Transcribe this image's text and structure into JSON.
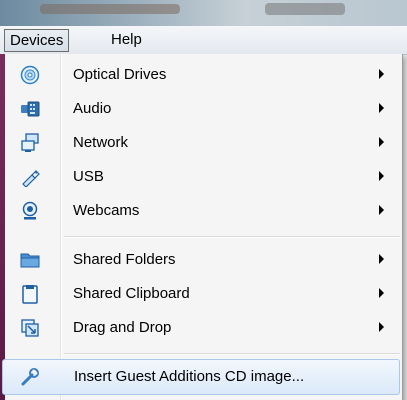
{
  "menubar": {
    "items": [
      {
        "label": "Devices"
      },
      {
        "label": "Help"
      }
    ]
  },
  "devices_menu": {
    "items": [
      {
        "label": "Optical Drives",
        "icon": "optical-disc-icon",
        "submenu": true
      },
      {
        "label": "Audio",
        "icon": "audio-card-icon",
        "submenu": true
      },
      {
        "label": "Network",
        "icon": "network-icon",
        "submenu": true
      },
      {
        "label": "USB",
        "icon": "usb-icon",
        "submenu": true
      },
      {
        "label": "Webcams",
        "icon": "webcam-icon",
        "submenu": true
      },
      {
        "label": "Shared Folders",
        "icon": "folder-icon",
        "submenu": true
      },
      {
        "label": "Shared Clipboard",
        "icon": "clipboard-icon",
        "submenu": true
      },
      {
        "label": "Drag and Drop",
        "icon": "drag-drop-icon",
        "submenu": true
      },
      {
        "label": "Insert Guest Additions CD image...",
        "icon": "wrench-icon",
        "submenu": false,
        "highlighted": true
      }
    ]
  },
  "colors": {
    "menu_bg": "#f5f5f5",
    "highlight_border": "#a8c8ec",
    "accent_left": "#7a2d5b"
  }
}
